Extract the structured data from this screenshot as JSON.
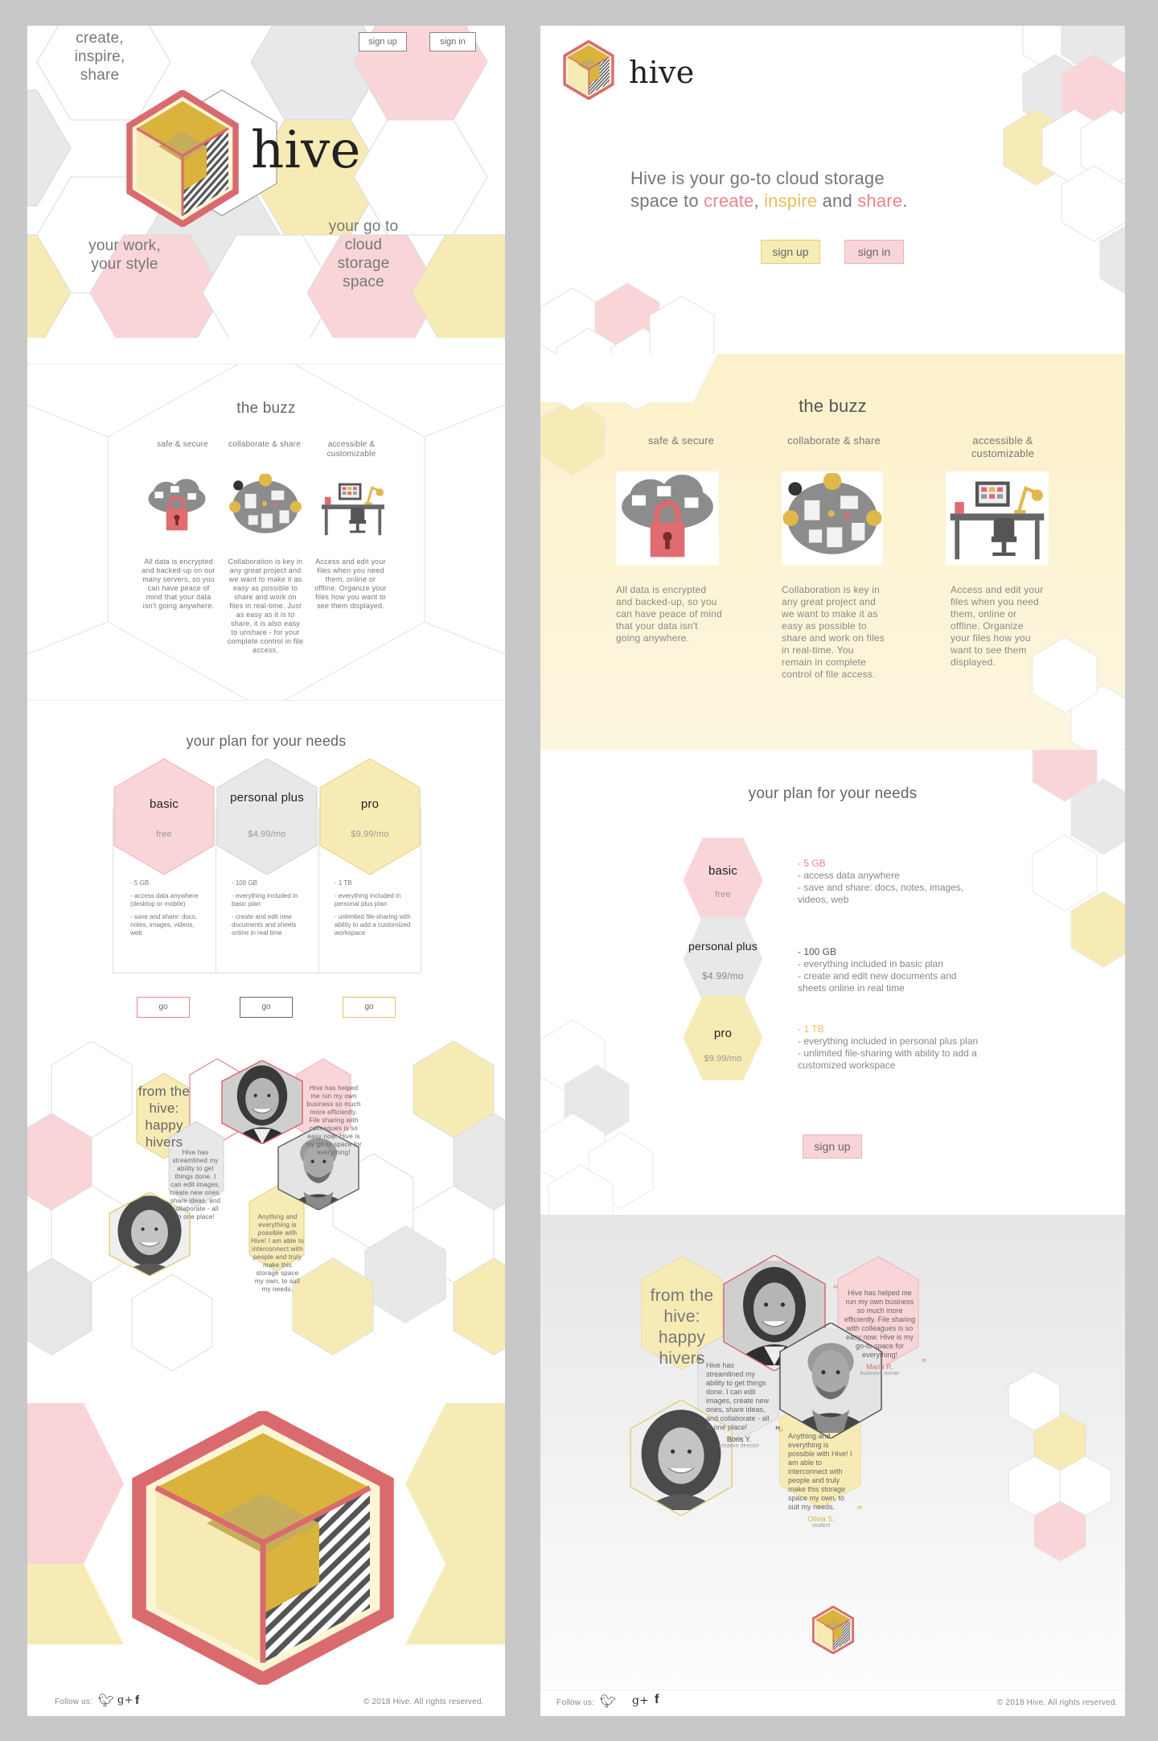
{
  "colors": {
    "pink": "#f9d5d8",
    "gold": "#f7ebb5",
    "grey": "#e8e8e8",
    "red": "#d96b6f",
    "mustard": "#d9b33b",
    "olive": "#c6ad5c"
  },
  "left": {
    "hero": {
      "tagline1": "create, inspire, share",
      "tagline2": "your work, your style",
      "tagline3": "your go to cloud storage space",
      "logo_text": "hive",
      "signup": "sign up",
      "signin": "sign in"
    },
    "buzz": {
      "title": "the buzz",
      "features": [
        {
          "title": "safe & secure",
          "text": "All data is encrypted and backed-up on our many servers, so you can have peace of mind that your data isn't going anywhere.",
          "icon": "cloud-lock-icon"
        },
        {
          "title": "collaborate & share",
          "text": "Collaboration is key in any great project and we want to make it as easy as possible to share and work on files in real-time. Just as easy as it is to share, it is also easy to unshare - for your complete control in file access.",
          "icon": "collaboration-table-icon"
        },
        {
          "title": "accessible & customizable",
          "text": "Access and edit your files when you need them, online or offline. Organize your files how you want to see them displayed.",
          "icon": "desk-workspace-icon"
        }
      ]
    },
    "plans": {
      "title": "your plan for your needs",
      "items": [
        {
          "name": "basic",
          "price": "free",
          "features": [
            "- 5 GB",
            "- access data anywhere (desktop or mobile)",
            "- save and share: docs, notes, images, videos, web"
          ],
          "cta": "go"
        },
        {
          "name": "personal plus",
          "price": "$4.99/mo",
          "features": [
            "- 100 GB",
            "- everything included in basic plan",
            "- create and edit new documents and sheets online in real time"
          ],
          "cta": "go"
        },
        {
          "name": "pro",
          "price": "$9.99/mo",
          "features": [
            "- 1 TB",
            "- everything included in personal plus plan",
            "- unlimited file-sharing with ability to add a customized workspace"
          ],
          "cta": "go"
        }
      ]
    },
    "testimonials": {
      "title": "from the hive: happy hivers",
      "quotes": [
        "Hive has helped me run my own business so much more efficiently. File sharing with colleagues is so easy now. Hive is my go-to space for everything!",
        "Hive has streamlined my ability to get things done. I can edit images, create new ones, share ideas, and collaborate - all in one place!",
        "Anything and everything is possible with Hive! I am able to interconnect with people and truly make this storage space my own, to suit my needs."
      ]
    },
    "footer": {
      "follow": "Follow us:",
      "copyright": "© 2018 Hive. All rights reserved."
    }
  },
  "right": {
    "hero": {
      "logo_text": "hive",
      "headline_start": "Hive is your go-to cloud storage space to",
      "w1": "create",
      "sep1": ",",
      "w2": "inspire",
      "and": "and",
      "w3": "share",
      "dot": ".",
      "signup": "sign up",
      "signin": "sign in"
    },
    "buzz": {
      "title": "the buzz",
      "features": [
        {
          "title": "safe & secure",
          "text": "All data is encrypted and backed-up, so you can have peace of mind that your data isn't going anywhere."
        },
        {
          "title": "collaborate & share",
          "text": "Collaboration is key in any great project and we want to make it as easy as possible to share and work on files in real-time. You remain in complete control of file access."
        },
        {
          "title": "accessible & customizable",
          "text": "Access and edit your files when you need them, online or offline. Organize your files how you want to see them displayed."
        }
      ]
    },
    "plans": {
      "title": "your plan for your needs",
      "items": [
        {
          "name": "basic",
          "price": "free",
          "features": [
            "- 5 GB",
            "- access data anywhere",
            "- save and share: docs, notes, images, videos, web"
          ]
        },
        {
          "name": "personal plus",
          "price": "$4.99/mo",
          "features": [
            "- 100 GB",
            "- everything included in basic plan",
            "- create and edit new documents and sheets online in real time"
          ]
        },
        {
          "name": "pro",
          "price": "$9.99/mo",
          "features": [
            "- 1 TB",
            "- everything included in personal plus plan",
            "- unlimited file-sharing with ability to add a customized workspace"
          ]
        }
      ],
      "cta": "sign up"
    },
    "testimonials": {
      "title": "from the hive: happy hivers",
      "quotes": [
        {
          "text": "Hive has helped me run my own business so much more efficiently. File sharing with colleagues is so easy now. Hive is my go-to space for everything!",
          "author": "Maria R.",
          "role": "business owner"
        },
        {
          "text": "Hive has streamlined my ability to get things done. I can edit images, create new ones, share ideas, and collaborate - all in one place!",
          "author": "Boris Y.",
          "role": "creative director"
        },
        {
          "text": "Anything and everything is possible with Hive! I am able to interconnect with people and truly make this storage space my own, to suit my needs.",
          "author": "Olivia S.",
          "role": "student"
        }
      ]
    },
    "footer": {
      "follow": "Follow us:",
      "copyright": "© 2018 Hive. All rights reserved."
    }
  }
}
